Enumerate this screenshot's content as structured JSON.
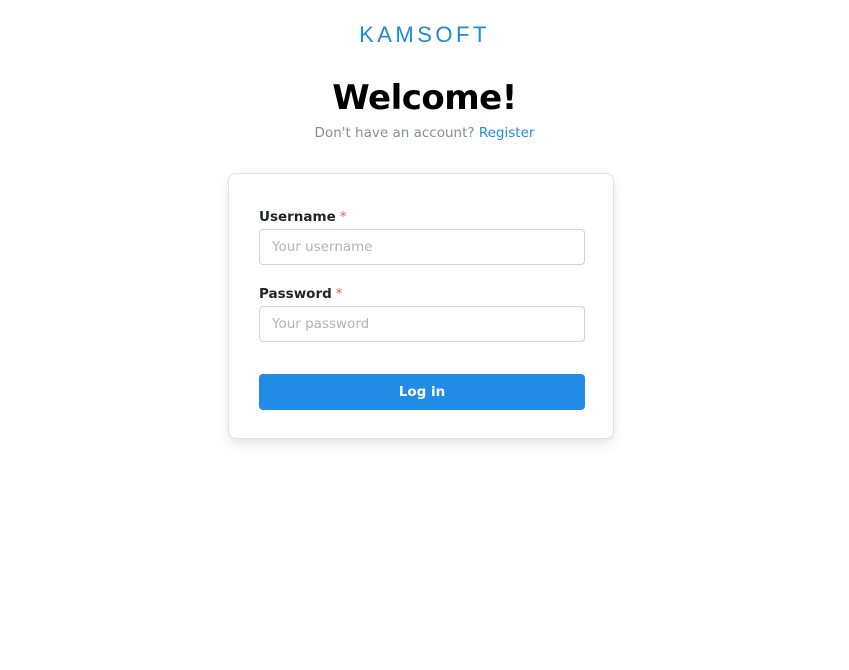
{
  "brand": {
    "logo_text": "KAMSOFT",
    "accent_color": "#228be6"
  },
  "header": {
    "title": "Welcome!",
    "prompt_text": "Don't have an account?",
    "register_link": "Register"
  },
  "form": {
    "username": {
      "label": "Username",
      "required_marker": "*",
      "placeholder": "Your username",
      "value": ""
    },
    "password": {
      "label": "Password",
      "required_marker": "*",
      "placeholder": "Your password",
      "value": ""
    },
    "submit_label": "Log in"
  }
}
